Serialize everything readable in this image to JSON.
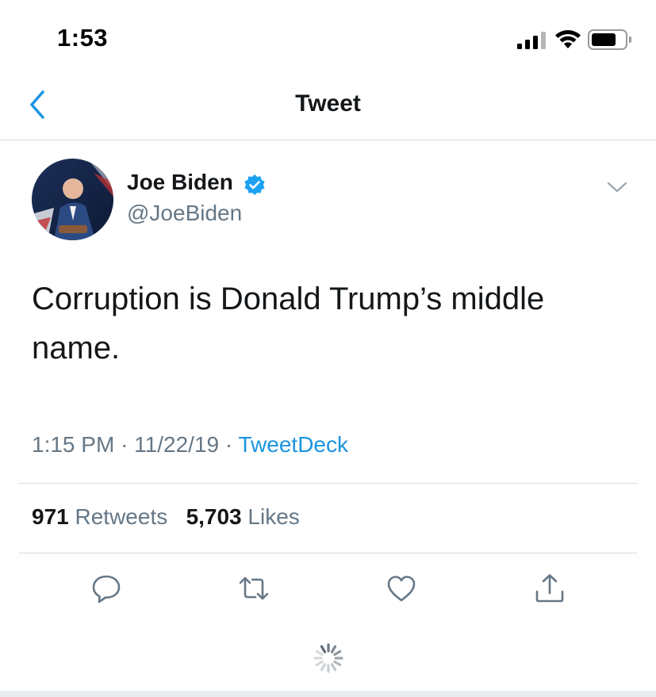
{
  "status_bar": {
    "time": "1:53"
  },
  "header": {
    "title": "Tweet",
    "back_icon": "chevron-left-icon"
  },
  "tweet": {
    "author": {
      "name": "Joe Biden",
      "handle": "@JoeBiden",
      "verified": true
    },
    "text": "Corruption is Donald Trump’s middle name.",
    "time": "1:15 PM",
    "date": "11/22/19",
    "separator": "·",
    "source": "TweetDeck",
    "retweets": {
      "count": "971",
      "label": "Retweets"
    },
    "likes": {
      "count": "5,703",
      "label": "Likes"
    }
  },
  "actions": [
    {
      "name": "reply",
      "icon": "speech-bubble-icon"
    },
    {
      "name": "retweet",
      "icon": "retweet-arrows-icon"
    },
    {
      "name": "like",
      "icon": "heart-icon"
    },
    {
      "name": "share",
      "icon": "share-upload-icon"
    }
  ],
  "colors": {
    "accent": "#1b95e0",
    "verified": "#1da1f2",
    "text_primary": "#14171a",
    "text_secondary": "#657786",
    "divider": "#d6d9dc"
  }
}
